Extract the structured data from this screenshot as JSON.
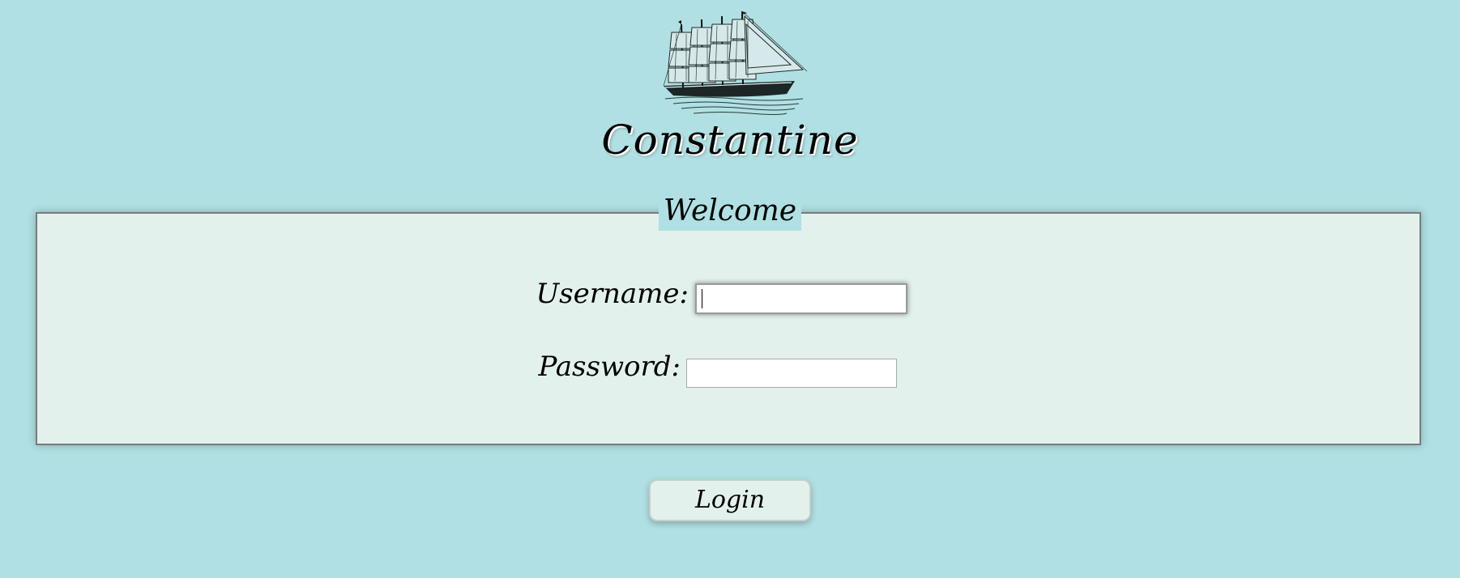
{
  "app": {
    "title": "Constantine",
    "logo_icon": "sailing-ship-icon"
  },
  "form": {
    "legend": "Welcome",
    "username_label": "Username:",
    "username_value": "",
    "password_label": "Password:",
    "password_value": "",
    "login_label": "Login"
  },
  "colors": {
    "background": "#b0e0e3",
    "panel": "#e2f1ec",
    "panel_border": "#7a7a7a",
    "text": "#000000"
  }
}
